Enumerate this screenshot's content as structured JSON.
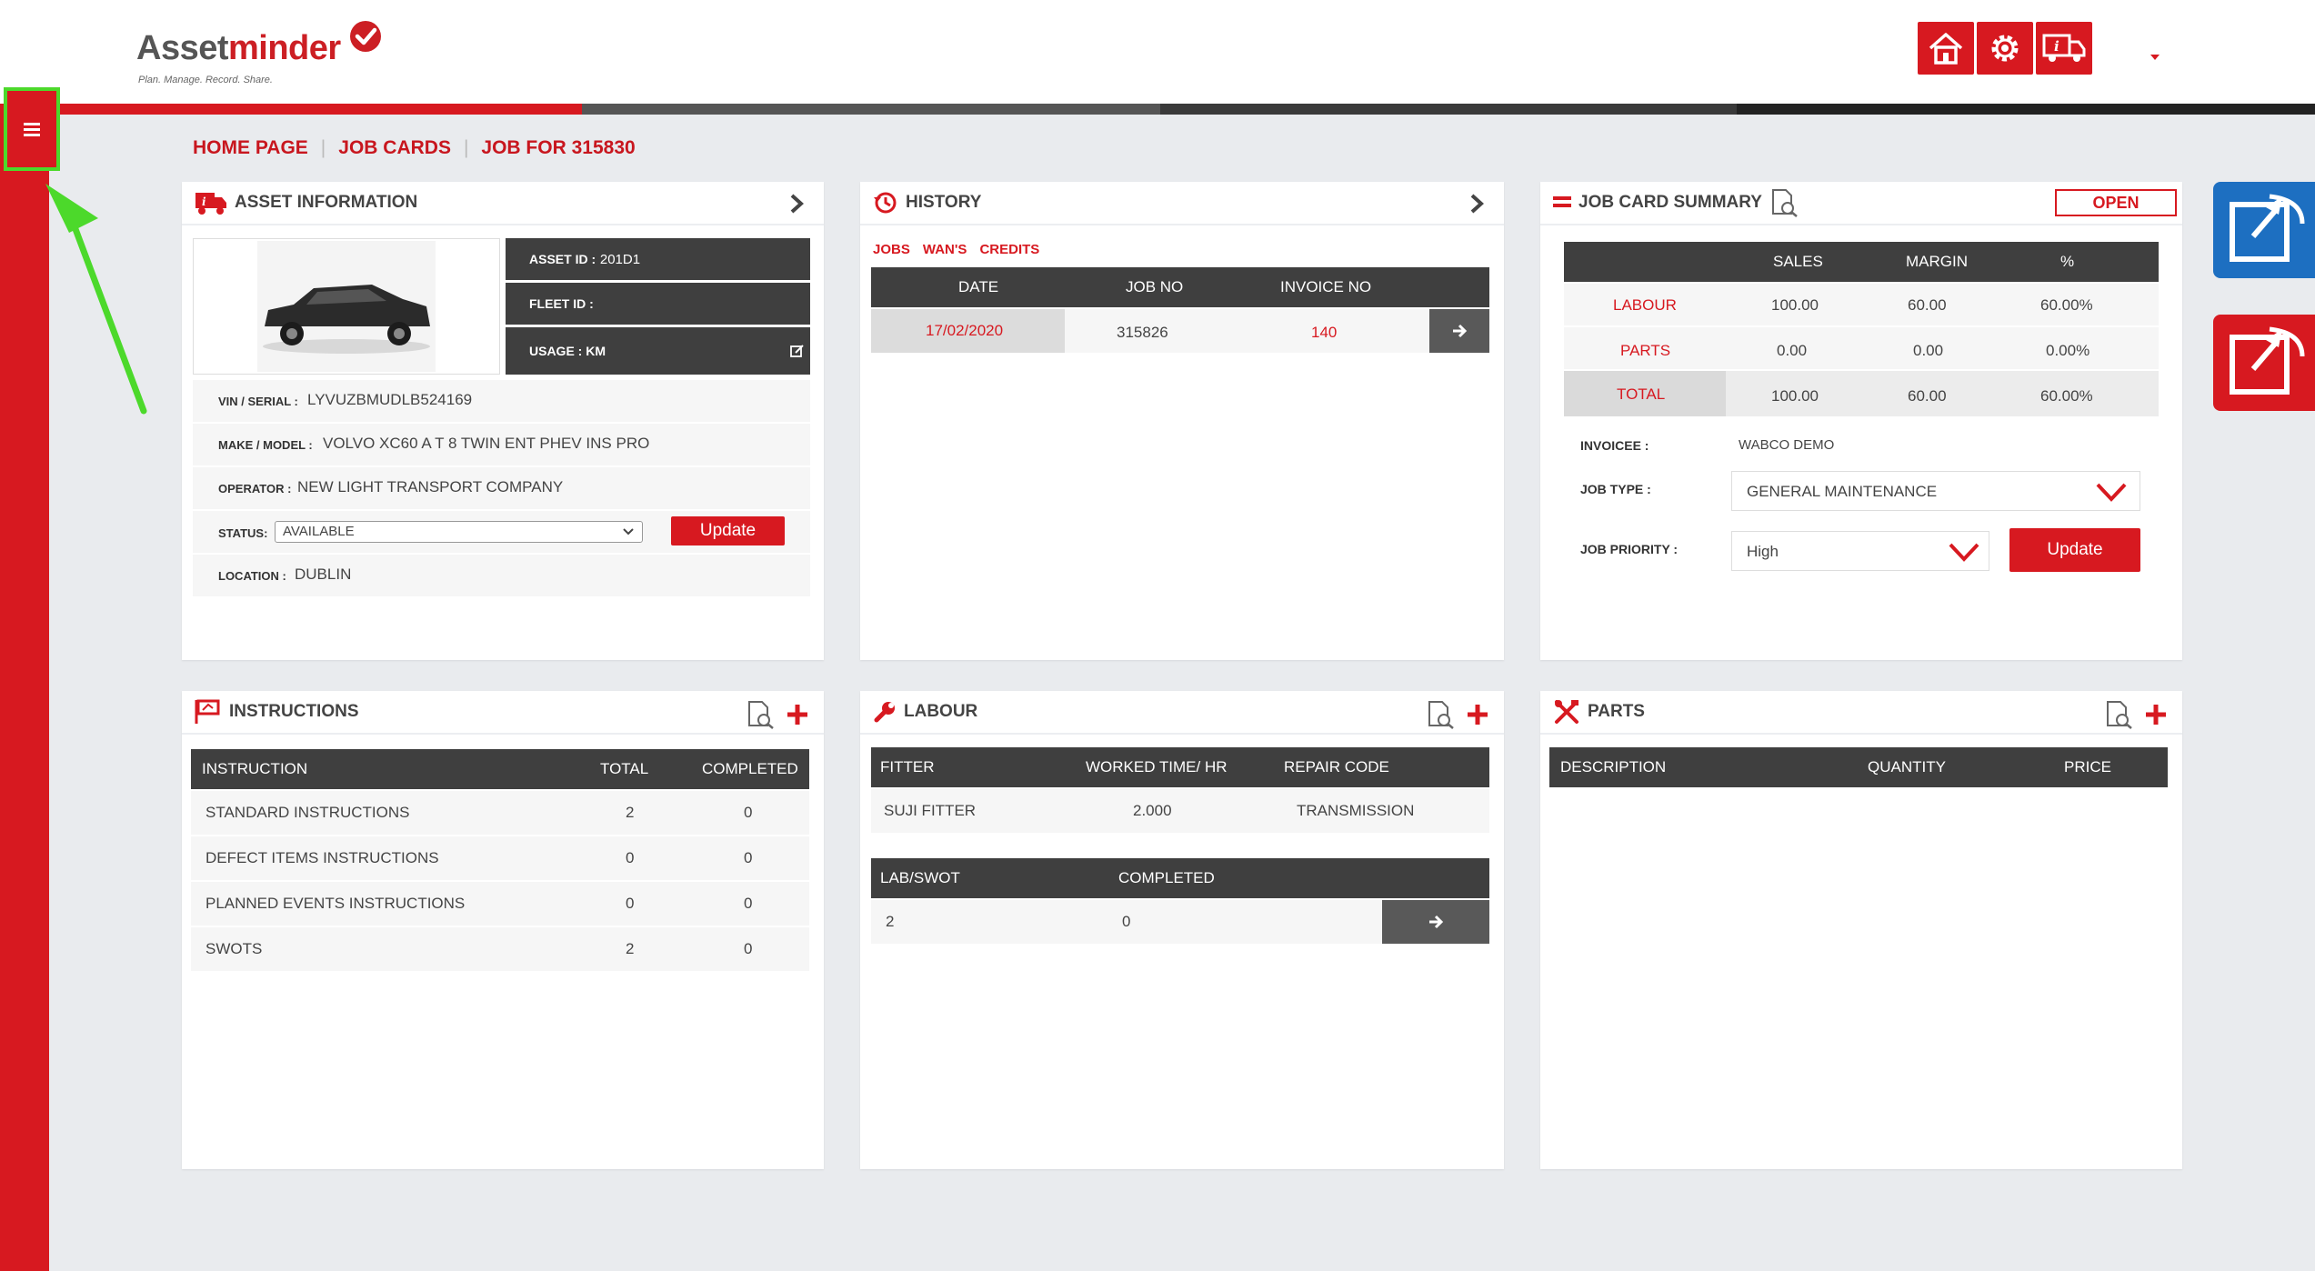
{
  "app": {
    "logo_part1": "Asset",
    "logo_part2": "minder",
    "tagline": "Plan. Manage. Record. Share."
  },
  "header_buttons": [
    {
      "icon": "home-icon"
    },
    {
      "icon": "settings-icon"
    },
    {
      "icon": "truck-info-icon"
    }
  ],
  "colors": {
    "accent": "#d71920",
    "dark": "#3f3f3f",
    "highlight": "#4cd92b",
    "blue_tab": "#1d6fc1"
  },
  "breadcrumb": {
    "home": "HOME PAGE",
    "job_cards": "JOB CARDS",
    "current": "JOB FOR 315830"
  },
  "asset_info": {
    "title": "ASSET INFORMATION",
    "asset_id_label": "ASSET ID :",
    "asset_id": "201D1",
    "fleet_id_label": "FLEET ID :",
    "fleet_id": "",
    "usage_label": "USAGE : KM",
    "vin_label": "VIN / SERIAL :",
    "vin": "LYVUZBMUDLB524169",
    "make_label": "MAKE / MODEL :",
    "make": "VOLVO XC60 A T 8 TWIN ENT PHEV INS PRO",
    "operator_label": "OPERATOR :",
    "operator": "NEW LIGHT TRANSPORT COMPANY",
    "status_label": "STATUS:",
    "status_value": "AVAILABLE",
    "update_label": "Update",
    "location_label": "LOCATION :",
    "location": "DUBLIN"
  },
  "history": {
    "title": "HISTORY",
    "tabs": [
      "JOBS",
      "WAN'S",
      "CREDITS"
    ],
    "columns": [
      "DATE",
      "JOB NO",
      "INVOICE NO"
    ],
    "rows": [
      {
        "date": "17/02/2020",
        "job_no": "315826",
        "invoice_no": "140"
      }
    ]
  },
  "summary": {
    "title": "JOB CARD SUMMARY",
    "status_badge": "OPEN",
    "columns": [
      "SALES",
      "MARGIN",
      "%"
    ],
    "rows": [
      {
        "label": "LABOUR",
        "sales": "100.00",
        "margin": "60.00",
        "pct": "60.00%"
      },
      {
        "label": "PARTS",
        "sales": "0.00",
        "margin": "0.00",
        "pct": "0.00%"
      },
      {
        "label": "TOTAL",
        "sales": "100.00",
        "margin": "60.00",
        "pct": "60.00%"
      }
    ],
    "invoicee_label": "INVOICEE :",
    "invoicee": "WABCO DEMO",
    "job_type_label": "JOB TYPE :",
    "job_type": "GENERAL MAINTENANCE",
    "priority_label": "JOB PRIORITY :",
    "priority": "High",
    "update_label": "Update"
  },
  "instructions": {
    "title": "INSTRUCTIONS",
    "columns": [
      "INSTRUCTION",
      "TOTAL",
      "COMPLETED"
    ],
    "rows": [
      {
        "name": "STANDARD INSTRUCTIONS",
        "total": "2",
        "completed": "0"
      },
      {
        "name": "DEFECT ITEMS INSTRUCTIONS",
        "total": "0",
        "completed": "0"
      },
      {
        "name": "PLANNED EVENTS INSTRUCTIONS",
        "total": "0",
        "completed": "0"
      },
      {
        "name": "SWOTS",
        "total": "2",
        "completed": "0"
      }
    ]
  },
  "labour": {
    "title": "LABOUR",
    "columns": [
      "FITTER",
      "WORKED TIME/ HR",
      "REPAIR CODE"
    ],
    "rows": [
      {
        "fitter": "SUJI FITTER",
        "time": "2.000",
        "code": "TRANSMISSION"
      }
    ],
    "swot_columns": [
      "LAB/SWOT",
      "COMPLETED"
    ],
    "swot_rows": [
      {
        "lab": "2",
        "completed": "0"
      }
    ]
  },
  "parts": {
    "title": "PARTS",
    "columns": [
      "DESCRIPTION",
      "QUANTITY",
      "PRICE"
    ]
  }
}
